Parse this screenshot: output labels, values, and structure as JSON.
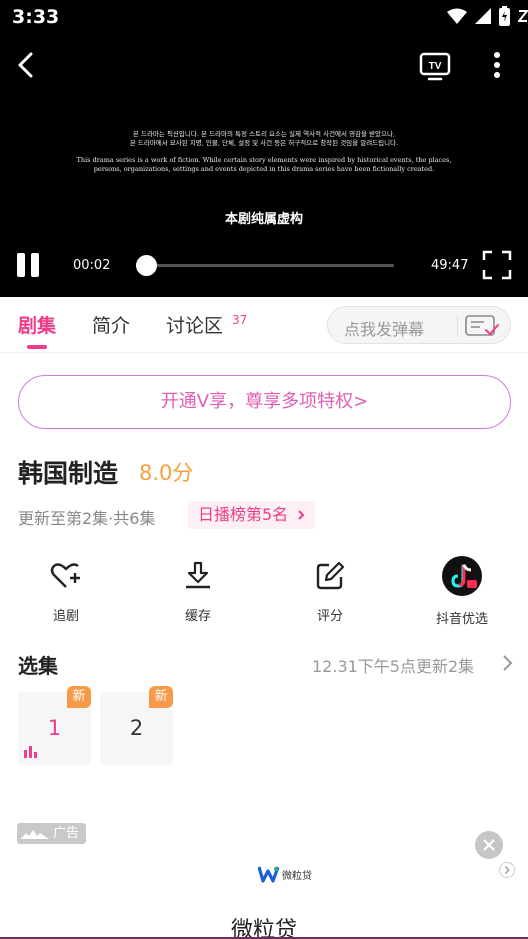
{
  "status_bar": {
    "time": "3:33"
  },
  "player": {
    "disclaimer_korean": [
      "본 드라마는 픽션입니다. 본 드라마의 특정 스토리 요소는 실제 역사적 사건에서 영감을 받았으나,",
      "본 드라마에서 묘사된 지명, 인물, 단체, 설정 및 사건 등은 허구적으로 창작된 것임을 알려드립니다."
    ],
    "disclaimer_english": [
      "This drama series is a work of fiction. While certain story elements were inspired by historical events, the places,",
      "persons, organizations, settings and events depicted in this drama series have been fictionally created."
    ],
    "subtitle": "本剧纯属虚构",
    "current_time": "00:02",
    "total_time": "49:47",
    "progress_fraction": 0.0
  },
  "tabs": {
    "items": [
      "剧集",
      "简介",
      "讨论区"
    ],
    "active_index": 0,
    "discussion_count": "37",
    "danmaku_placeholder": "点我发弹幕"
  },
  "vip_banner": "开通V享，尊享多项特权>",
  "show": {
    "title": "韩国制造",
    "score": "8.0分",
    "update_info": "更新至第2集·共6集",
    "rank_badge": "日播榜第5名"
  },
  "actions": [
    {
      "label": "追剧",
      "icon": "heart-plus-icon"
    },
    {
      "label": "缓存",
      "icon": "download-icon"
    },
    {
      "label": "评分",
      "icon": "edit-icon"
    },
    {
      "label": "抖音优选",
      "icon": "douyin-shop-icon"
    }
  ],
  "episodes": {
    "title": "选集",
    "update_schedule": "12.31下午5点更新2集",
    "items": [
      {
        "number": "1",
        "badge": "新",
        "playing": true
      },
      {
        "number": "2",
        "badge": "新",
        "playing": false
      }
    ]
  },
  "ad": {
    "tag": "广告",
    "logo_text": "微粒贷",
    "name": "微粒贷"
  },
  "colors": {
    "accent": "#ee3d8a",
    "score": "#f5a13e",
    "new_badge": "#f69a4a"
  }
}
